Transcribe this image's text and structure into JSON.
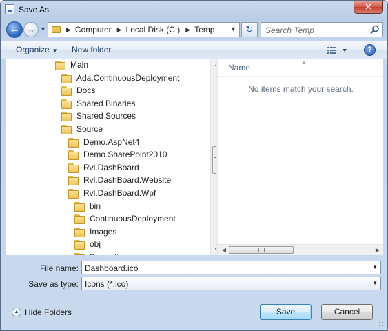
{
  "window": {
    "title": "Save As",
    "close_label": "✕"
  },
  "address": {
    "crumbs": [
      "Computer",
      "Local Disk (C:)",
      "Temp"
    ],
    "search_placeholder": "Search Temp"
  },
  "toolbar": {
    "organize_label": "Organize",
    "new_folder_label": "New folder",
    "help_label": "?"
  },
  "tree": {
    "items": [
      {
        "label": "Main",
        "level": 0
      },
      {
        "label": "Ada.ContinuousDeployment",
        "level": 1
      },
      {
        "label": "Docs",
        "level": 1
      },
      {
        "label": "Shared Binaries",
        "level": 1
      },
      {
        "label": "Shared Sources",
        "level": 1
      },
      {
        "label": "Source",
        "level": 1
      },
      {
        "label": "Demo.AspNet4",
        "level": 2
      },
      {
        "label": "Demo.SharePoint2010",
        "level": 2
      },
      {
        "label": "Rvl.DashBoard",
        "level": 2
      },
      {
        "label": "Rvl.DashBoard.Website",
        "level": 2
      },
      {
        "label": "Rvl.DashBoard.Wpf",
        "level": 2
      },
      {
        "label": "bin",
        "level": 3
      },
      {
        "label": "ContinuousDeployment",
        "level": 3
      },
      {
        "label": "Images",
        "level": 3
      },
      {
        "label": "obj",
        "level": 3
      },
      {
        "label": "Properties",
        "level": 3
      }
    ]
  },
  "file_list": {
    "column_name": "Name",
    "empty_message": "No items match your search."
  },
  "fields": {
    "file_name_label_pre": "File ",
    "file_name_label_key": "n",
    "file_name_label_post": "ame:",
    "file_name_value": "Dashboard.ico",
    "save_type_label_pre": "Save as ",
    "save_type_label_key": "t",
    "save_type_label_post": "ype:",
    "save_type_value": "Icons (*.ico)"
  },
  "footer": {
    "hide_folders_label": "Hide Folders",
    "save_label": "Save",
    "cancel_label": "Cancel"
  },
  "colors": {
    "accent": "#3c7fb1",
    "frame": "#c9d9ee",
    "close": "#c3402f"
  }
}
